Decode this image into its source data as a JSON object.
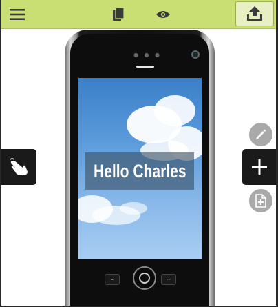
{
  "toolbar": {
    "background": "#c9df73",
    "menu_icon": "hamburger-menu-icon",
    "pages_icon": "pages-icon",
    "preview_icon": "eye-icon",
    "export_icon": "upload-icon"
  },
  "device": {
    "type": "smartphone-mockup",
    "screen": {
      "background": "sky-with-clouds",
      "text": "Hello Charles"
    }
  },
  "left_panel": {
    "icon": "hand-pointer-icon"
  },
  "right_panel": {
    "edit_icon": "pencil-icon",
    "add_icon": "plus-icon",
    "add_page_icon": "add-page-icon"
  }
}
